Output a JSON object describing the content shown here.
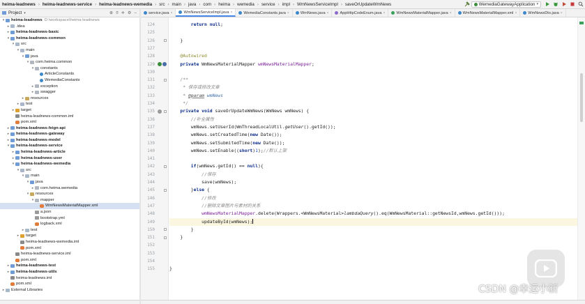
{
  "navbar": {
    "crumbs": [
      "heima-leadnews",
      "heima-leadnews-service",
      "heima-leadnews-wemedia",
      "src",
      "main",
      "java",
      "com",
      "heima",
      "wemedia",
      "service",
      "impl",
      "WmNewsServiceImpl",
      "saveOrUpdateWmNews"
    ],
    "run_config": "WemediaGatewayApplication"
  },
  "project": {
    "title": "Project",
    "tree": [
      {
        "label": "heima-leadnews",
        "extra": "D:\\workspace\\heima-leadnews",
        "depth": 0,
        "icon": "module",
        "open": true,
        "bold": true
      },
      {
        "label": ".idea",
        "depth": 1,
        "icon": "folder",
        "open": false
      },
      {
        "label": "heima-leadnews-basic",
        "depth": 1,
        "icon": "module",
        "open": false,
        "bold": true
      },
      {
        "label": "heima-leadnews-common",
        "depth": 1,
        "icon": "module",
        "open": true,
        "bold": true
      },
      {
        "label": "src",
        "depth": 2,
        "icon": "folder",
        "open": true
      },
      {
        "label": "main",
        "depth": 3,
        "icon": "folder",
        "open": true
      },
      {
        "label": "java",
        "depth": 4,
        "icon": "src",
        "open": true
      },
      {
        "label": "com.heima.common",
        "depth": 5,
        "icon": "pkg",
        "open": true
      },
      {
        "label": "constants",
        "depth": 6,
        "icon": "pkg",
        "open": true
      },
      {
        "label": "ArticleConstants",
        "depth": 7,
        "icon": "cls"
      },
      {
        "label": "WemediaConstants",
        "depth": 7,
        "icon": "cls"
      },
      {
        "label": "exception",
        "depth": 6,
        "icon": "pkg",
        "open": false
      },
      {
        "label": "swagger",
        "depth": 6,
        "icon": "pkg",
        "open": false
      },
      {
        "label": "resources",
        "depth": 4,
        "icon": "res",
        "open": false
      },
      {
        "label": "test",
        "depth": 3,
        "icon": "folder",
        "open": false
      },
      {
        "label": "target",
        "depth": 2,
        "icon": "target",
        "open": false
      },
      {
        "label": "heima-leadnews-common.iml",
        "depth": 2,
        "icon": "iml"
      },
      {
        "label": "pom.xml",
        "depth": 2,
        "icon": "xml"
      },
      {
        "label": "heima-leadnews-feign-api",
        "depth": 1,
        "icon": "module",
        "open": false,
        "bold": true
      },
      {
        "label": "heima-leadnews-gateway",
        "depth": 1,
        "icon": "module",
        "open": false,
        "bold": true
      },
      {
        "label": "heima-leadnews-model",
        "depth": 1,
        "icon": "module",
        "open": false,
        "bold": true
      },
      {
        "label": "heima-leadnews-service",
        "depth": 1,
        "icon": "module",
        "open": true,
        "bold": true
      },
      {
        "label": "heima-leadnews-article",
        "depth": 2,
        "icon": "module",
        "open": false,
        "bold": true
      },
      {
        "label": "heima-leadnews-user",
        "depth": 2,
        "icon": "module",
        "open": false,
        "bold": true
      },
      {
        "label": "heima-leadnews-wemedia",
        "depth": 2,
        "icon": "module",
        "open": true,
        "bold": true
      },
      {
        "label": "src",
        "depth": 3,
        "icon": "folder",
        "open": true
      },
      {
        "label": "main",
        "depth": 4,
        "icon": "folder",
        "open": true
      },
      {
        "label": "java",
        "depth": 5,
        "icon": "src",
        "open": true
      },
      {
        "label": "com.heima.wemedia",
        "depth": 6,
        "icon": "pkg",
        "open": false
      },
      {
        "label": "resources",
        "depth": 5,
        "icon": "res",
        "open": true
      },
      {
        "label": "mapper",
        "depth": 6,
        "icon": "pkg",
        "open": true
      },
      {
        "label": "WmNewsMaterialMapper.xml",
        "depth": 7,
        "icon": "xml",
        "selected": true
      },
      {
        "label": "a.json",
        "depth": 6,
        "icon": "json"
      },
      {
        "label": "bootstrap.yml",
        "depth": 6,
        "icon": "json"
      },
      {
        "label": "logback.xml",
        "depth": 6,
        "icon": "xml"
      },
      {
        "label": "test",
        "depth": 4,
        "icon": "folder",
        "open": false
      },
      {
        "label": "target",
        "depth": 3,
        "icon": "target",
        "open": false
      },
      {
        "label": "heima-leadnews-wemedia.iml",
        "depth": 3,
        "icon": "iml"
      },
      {
        "label": "pom.xml",
        "depth": 3,
        "icon": "xml"
      },
      {
        "label": "heima-leadnews-service.iml",
        "depth": 2,
        "icon": "iml"
      },
      {
        "label": "pom.xml",
        "depth": 2,
        "icon": "xml"
      },
      {
        "label": "heima-leadnews-test",
        "depth": 1,
        "icon": "module",
        "open": false,
        "bold": true
      },
      {
        "label": "heima-leadnews-utils",
        "depth": 1,
        "icon": "module",
        "open": false,
        "bold": true
      },
      {
        "label": "heima-leadnews.iml",
        "depth": 1,
        "icon": "iml"
      },
      {
        "label": "pom.xml",
        "depth": 1,
        "icon": "xml"
      },
      {
        "label": "External Libraries",
        "depth": 0,
        "icon": "folder",
        "open": false
      }
    ]
  },
  "tabs": [
    {
      "label": "service.java",
      "kind": "class"
    },
    {
      "label": "WmNewsServiceImpl.java",
      "kind": "class",
      "active": true
    },
    {
      "label": "WemediaConstants.java",
      "kind": "class"
    },
    {
      "label": "WmNews.java",
      "kind": "class"
    },
    {
      "label": "AppHttpCodeEnum.java",
      "kind": "enum"
    },
    {
      "label": "WmNewsMaterialMapper.java",
      "kind": "iface"
    },
    {
      "label": "WmNewsMaterialMapper.xml",
      "kind": "class"
    },
    {
      "label": "WmNewsDto.java",
      "kind": "class"
    }
  ],
  "code": {
    "line_numbers": [
      "124",
      "125",
      "126",
      "127",
      "128",
      "129",
      "130",
      "131",
      "132",
      "133",
      "134",
      "135",
      "136",
      "137",
      "138",
      "139",
      "140",
      "141",
      "142",
      "143",
      "144",
      "145",
      "146",
      "147",
      "148",
      "149",
      "150",
      "151",
      "152",
      "153",
      "154",
      "155"
    ],
    "highlight_line": "149"
  },
  "watermark": {
    "text": "CSDN @幸运小新"
  }
}
